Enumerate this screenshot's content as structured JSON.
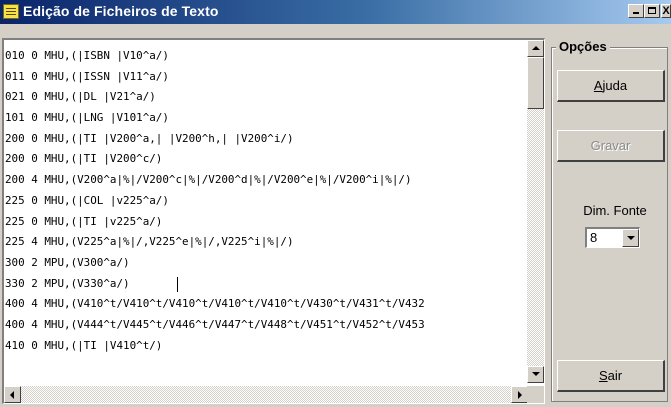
{
  "window": {
    "title": "Edição de Ficheiros de Texto",
    "minimize_label": "_",
    "maximize_label": "□",
    "close_label": "X"
  },
  "editor": {
    "lines": [
      "010 0 MHU,(|ISBN |V10^a/)",
      "011 0 MHU,(|ISSN |V11^a/)",
      "021 0 MHU,(|DL |V21^a/)",
      "101 0 MHU,(|LNG |V101^a/)",
      "200 0 MHU,(|TI |V200^a,| |V200^h,| |V200^i/)",
      "200 0 MHU,(|TI |V200^c/)",
      "200 4 MHU,(V200^a|%|/V200^c|%|/V200^d|%|/V200^e|%|/V200^i|%|/)",
      "225 0 MHU,(|COL |v225^a/)",
      "225 0 MHU,(|TI |v225^a/)",
      "225 4 MHU,(V225^a|%|/,V225^e|%|/,V225^i|%|/)",
      "300 2 MPU,(V300^a/)",
      "330 2 MPU,(V330^a/)",
      "400 4 MHU,(V410^t/V410^t/V410^t/V410^t/V410^t/V430^t/V431^t/V432",
      "400 4 MHU,(V444^t/V445^t/V446^t/V447^t/V448^t/V451^t/V452^t/V453",
      "410 0 MHU,(|TI |V410^t/)"
    ]
  },
  "options": {
    "group_title": "Opções",
    "help_label": "Ajuda",
    "help_accel": "A",
    "save_label": "Gravar",
    "font_size_label": "Dim. Fonte",
    "font_size_value": "8",
    "exit_label": "Sair",
    "exit_accel": "S"
  },
  "colors": {
    "titlebar_start": "#0a246a",
    "titlebar_end": "#a6caf0",
    "face": "#d4d0c8"
  }
}
